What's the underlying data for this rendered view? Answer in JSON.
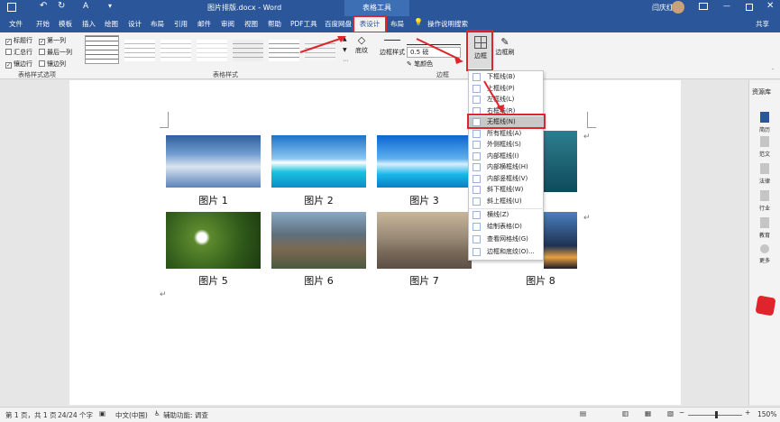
{
  "title": {
    "filename": "图片排版.docx - Word",
    "context_tab": "表格工具",
    "user": "闫庆红"
  },
  "quick_access": [
    "save",
    "undo",
    "redo",
    "font-color",
    "more"
  ],
  "tabs": [
    {
      "label": "文件"
    },
    {
      "label": "开始"
    },
    {
      "label": "模板"
    },
    {
      "label": "插入"
    },
    {
      "label": "绘图"
    },
    {
      "label": "设计"
    },
    {
      "label": "布局"
    },
    {
      "label": "引用"
    },
    {
      "label": "邮件"
    },
    {
      "label": "审阅"
    },
    {
      "label": "视图"
    },
    {
      "label": "帮助"
    },
    {
      "label": "PDF工具"
    },
    {
      "label": "百度网盘"
    },
    {
      "label": "表设计",
      "active": true
    },
    {
      "label": "布局"
    }
  ],
  "tell_me": "操作说明搜索",
  "share": "共享",
  "table_style_options": {
    "group_label": "表格样式选项",
    "checkboxes": [
      {
        "label": "标题行",
        "checked": true
      },
      {
        "label": "第一列",
        "checked": true
      },
      {
        "label": "汇总行",
        "checked": false
      },
      {
        "label": "最后一列",
        "checked": false
      },
      {
        "label": "镶边行",
        "checked": true
      },
      {
        "label": "镶边列",
        "checked": false
      }
    ]
  },
  "table_styles": {
    "group_label": "表格样式",
    "shading": "底纹"
  },
  "borders": {
    "group_label": "边框",
    "border_styles": "边框样式",
    "weight": "0.5 磅",
    "pen_color": "笔颜色",
    "borders_button": "边框",
    "border_painter": "边框刷"
  },
  "document": {
    "captions": [
      "图片 1",
      "图片 2",
      "图片 3",
      "图片 5",
      "图片 6",
      "图片 7",
      "图片 8"
    ],
    "return_mark": "↵"
  },
  "border_menu": {
    "items": [
      {
        "label": "下框线(B)"
      },
      {
        "label": "上框线(P)"
      },
      {
        "label": "左框线(L)"
      },
      {
        "label": "右框线(R)"
      },
      {
        "label": "无框线(N)",
        "highlighted": true
      },
      {
        "label": "所有框线(A)"
      },
      {
        "label": "外侧框线(S)"
      },
      {
        "label": "内部框线(I)"
      },
      {
        "label": "内部横框线(H)"
      },
      {
        "label": "内部竖框线(V)"
      },
      {
        "label": "斜下框线(W)"
      },
      {
        "label": "斜上框线(U)"
      },
      {
        "label": "横线(Z)"
      },
      {
        "label": "绘制表格(D)"
      },
      {
        "label": "查看网格线(G)"
      },
      {
        "label": "边框和底纹(O)..."
      }
    ]
  },
  "right_pane": {
    "title": "资源库",
    "items": [
      "简历",
      "范文",
      "法律",
      "行业",
      "教育",
      "更多"
    ]
  },
  "status": {
    "page": "第 1 页，共 1 页",
    "words": "24/24 个字",
    "language": "中文(中国)",
    "accessibility": "辅助功能: 调查",
    "zoom": "150%"
  },
  "colors": {
    "ribbon_blue": "#2b579a",
    "highlight_red": "#e0242b"
  }
}
